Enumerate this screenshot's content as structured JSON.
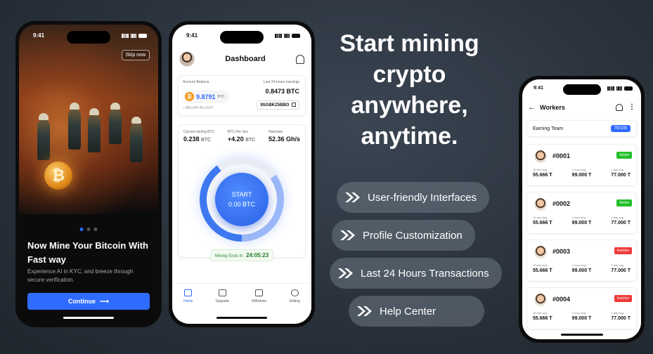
{
  "headline": "Start mining crypto anywhere, anytime.",
  "features": [
    "User-friendly Interfaces",
    "Profile Customization",
    "Last 24 Hours Transactions",
    "Help Center"
  ],
  "colors": {
    "accent": "#2f6bff",
    "active": "#22c02a",
    "inactive": "#ef3a3a",
    "success": "#1f7a1f"
  },
  "onboarding": {
    "time": "9:41",
    "skip": "Skip now",
    "coin_icon": "₿",
    "title": "Now Mine Your Bitcoin With Fast way",
    "subtitle": "Experience AI in KYC, and breeze through secure verification.",
    "continue": "Continue",
    "arrow": "⟶",
    "pages": 3,
    "current_page": 1
  },
  "dashboard": {
    "time": "9:41",
    "title": "Dashboard",
    "account_balance_label": "Account Balance",
    "btc_icon": "₿",
    "balance": "9.8791",
    "balance_unit": "BTC",
    "balance_usd": "≈ $88,640.49 USDT",
    "earnings_label": "Last 24-hours earnings",
    "earnings_value": "0.8473 BTC",
    "address": "9SGBKZ5BBO",
    "stats": [
      {
        "label": "Current mining BTC",
        "value": "0.238",
        "unit": "BTC"
      },
      {
        "label": "BTC Per Sec",
        "value": "+4.20",
        "unit": "BTC"
      },
      {
        "label": "Hashrate",
        "value": "52.36 Gh/s",
        "unit": ""
      }
    ],
    "start_label": "START",
    "start_value": "0.00 BTC",
    "ends_label": "Mining Ends In:",
    "ends_value": "24:05:23",
    "nav": [
      "Home",
      "Upgrade",
      "Withdraw",
      "Setting"
    ]
  },
  "workers": {
    "time": "9:41",
    "back": "←",
    "title": "Workers",
    "earning_team_label": "Earning Team",
    "earning_team_count": "75/100",
    "stat_labels": [
      "10-min avg.",
      "1-hour avg.",
      "1-day avg."
    ],
    "items": [
      {
        "id": "#0001",
        "status": "Active",
        "stats": [
          "55.666 T",
          "99.000 T",
          "77.000 T"
        ]
      },
      {
        "id": "#0002",
        "status": "Active",
        "stats": [
          "55.666 T",
          "99.000 T",
          "77.000 T"
        ]
      },
      {
        "id": "#0003",
        "status": "Inactive",
        "stats": [
          "55.666 T",
          "99.000 T",
          "77.000 T"
        ]
      },
      {
        "id": "#0004",
        "status": "Inactive",
        "stats": [
          "55.666 T",
          "99.000 T",
          "77.000 T"
        ]
      }
    ]
  }
}
